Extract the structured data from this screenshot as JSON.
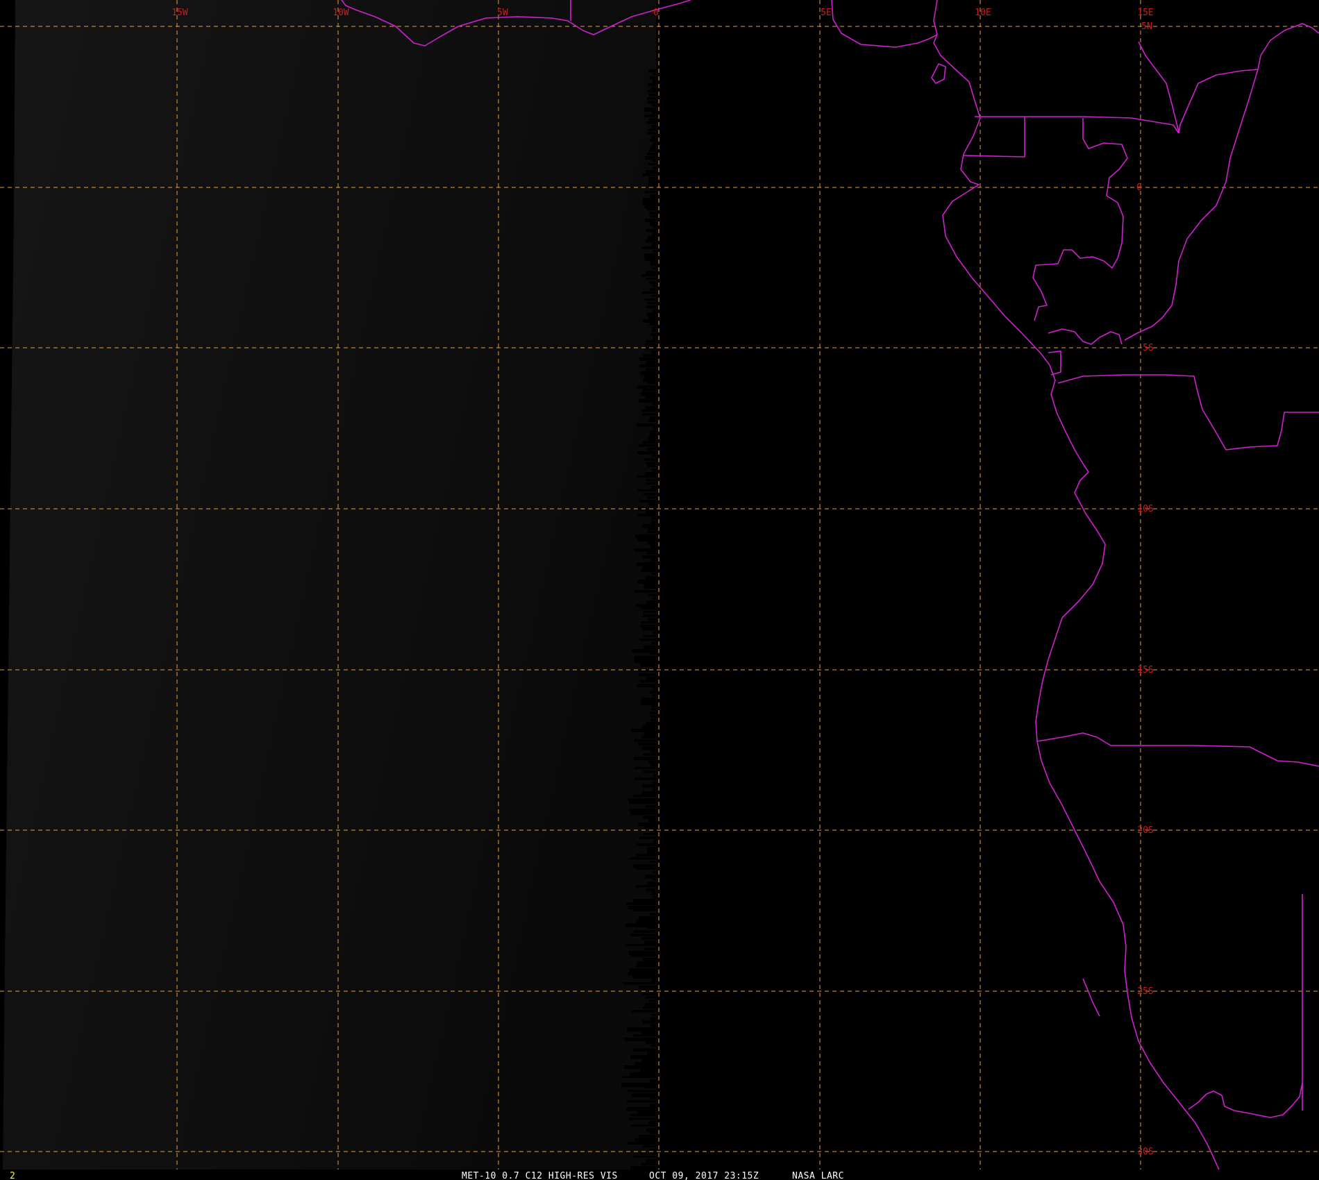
{
  "colors": {
    "background": "#000000",
    "grid": "#e8a040",
    "coastline": "#d020d0",
    "grid_label": "#d21a1a",
    "frame_label": "#ffff00",
    "status_text": "#ffffff"
  },
  "map": {
    "longitude_labels": [
      "15W",
      "10W",
      "5W",
      "0",
      "5E",
      "10E",
      "15E"
    ],
    "latitude_labels": [
      "5N",
      "0",
      "5S",
      "10S",
      "15S",
      "20S",
      "25S",
      "30S"
    ]
  },
  "frame": {
    "number": "2"
  },
  "status": {
    "product": "MET-10 0.7 C12 HIGH-RES VIS",
    "datetime": "OCT 09, 2017 23:15Z",
    "source": "NASA LARC"
  },
  "icons": {
    "map_type": "satellite-visible-map"
  }
}
